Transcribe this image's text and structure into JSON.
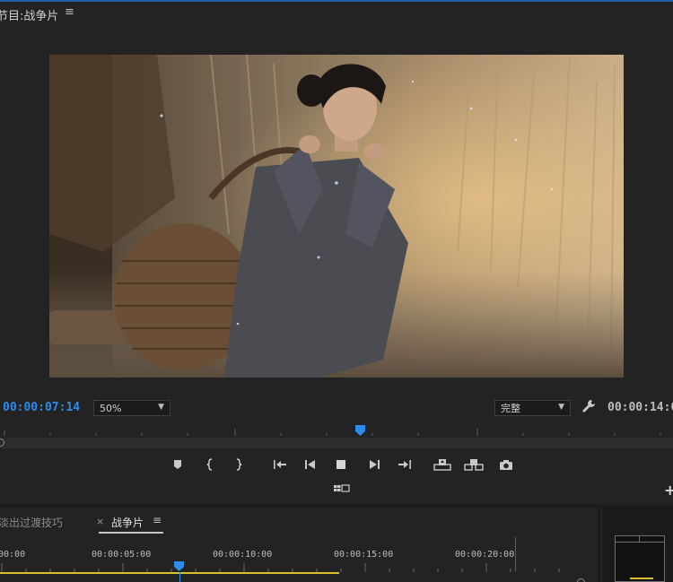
{
  "program_monitor": {
    "title": "节目:战争片",
    "menu_icon": "hamburger-menu-icon",
    "current_timecode": "00:00:07:14",
    "zoom_level": "50%",
    "playback_resolution": "完整",
    "duration_timecode": "00:00:14:0",
    "settings_icon": "wrench-icon",
    "playhead_position_fraction": 0.535,
    "transport_buttons": [
      "add-marker-icon",
      "mark-in-icon",
      "mark-out-icon",
      "go-to-in-icon",
      "step-back-icon",
      "stop-icon",
      "step-forward-icon",
      "go-to-out-icon",
      "lift-icon",
      "extract-icon",
      "export-frame-icon"
    ],
    "multicam_icon": "multicam-view-icon",
    "add_button_icon": "plus-icon"
  },
  "timeline": {
    "tabs": [
      {
        "label": "淡出过渡技巧",
        "active": false
      },
      {
        "label": "战争片",
        "active": true
      }
    ],
    "close_glyph": "×",
    "menu_icon": "hamburger-menu-icon",
    "time_labels": [
      "00:00",
      "00:00:05:00",
      "00:00:10:00",
      "00:00:15:00",
      "00:00:20:00"
    ],
    "playhead_time": "00:00:07:14"
  },
  "colors": {
    "accent_blue": "#2d8ceb",
    "in_out_yellow": "#d8c22a",
    "panel_bg": "#232323",
    "active_border": "#1f5fa8"
  }
}
